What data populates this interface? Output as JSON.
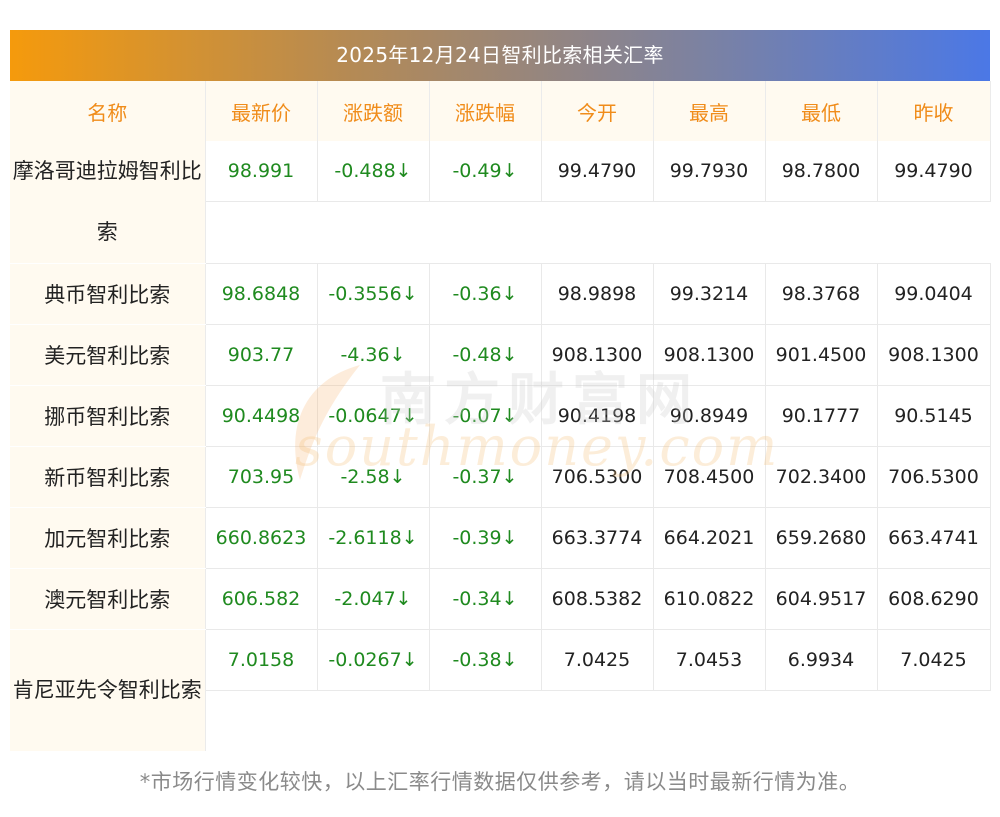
{
  "title": "2025年12月24日智利比索相关汇率",
  "columns": [
    "名称",
    "最新价",
    "涨跌额",
    "涨跌幅",
    "今开",
    "最高",
    "最低",
    "昨收"
  ],
  "rows": [
    {
      "name": "摩洛哥迪拉姆智利比索",
      "latest": "98.991",
      "change": "-0.488",
      "pct": "-0.49",
      "open": "99.4790",
      "high": "99.7930",
      "low": "98.7800",
      "prev": "99.4790"
    },
    {
      "name": "典币智利比索",
      "latest": "98.6848",
      "change": "-0.3556",
      "pct": "-0.36",
      "open": "98.9898",
      "high": "99.3214",
      "low": "98.3768",
      "prev": "99.0404"
    },
    {
      "name": "美元智利比索",
      "latest": "903.77",
      "change": "-4.36",
      "pct": "-0.48",
      "open": "908.1300",
      "high": "908.1300",
      "low": "901.4500",
      "prev": "908.1300"
    },
    {
      "name": "挪币智利比索",
      "latest": "90.4498",
      "change": "-0.0647",
      "pct": "-0.07",
      "open": "90.4198",
      "high": "90.8949",
      "low": "90.1777",
      "prev": "90.5145"
    },
    {
      "name": "新币智利比索",
      "latest": "703.95",
      "change": "-2.58",
      "pct": "-0.37",
      "open": "706.5300",
      "high": "708.4500",
      "low": "702.3400",
      "prev": "706.5300"
    },
    {
      "name": "加元智利比索",
      "latest": "660.8623",
      "change": "-2.6118",
      "pct": "-0.39",
      "open": "663.3774",
      "high": "664.2021",
      "low": "659.2680",
      "prev": "663.4741"
    },
    {
      "name": "澳元智利比索",
      "latest": "606.582",
      "change": "-2.047",
      "pct": "-0.34",
      "open": "608.5382",
      "high": "610.0822",
      "low": "604.9517",
      "prev": "608.6290"
    },
    {
      "name": "肯尼亚先令智利比索",
      "latest": "7.0158",
      "change": "-0.0267",
      "pct": "-0.38",
      "open": "7.0425",
      "high": "7.0453",
      "low": "6.9934",
      "prev": "7.0425"
    }
  ],
  "down_arrow": "↓",
  "watermark": {
    "cn": "南方财富网",
    "en": "southmoney.com"
  },
  "footer": "*市场行情变化较快，以上汇率行情数据仅供参考，请以当时最新行情为准。",
  "colors": {
    "header_text": "#f08c1a",
    "up_down_green": "#1f8a1f",
    "title_gradient_start": "#f59a0c",
    "title_gradient_end": "#4b78e6"
  }
}
